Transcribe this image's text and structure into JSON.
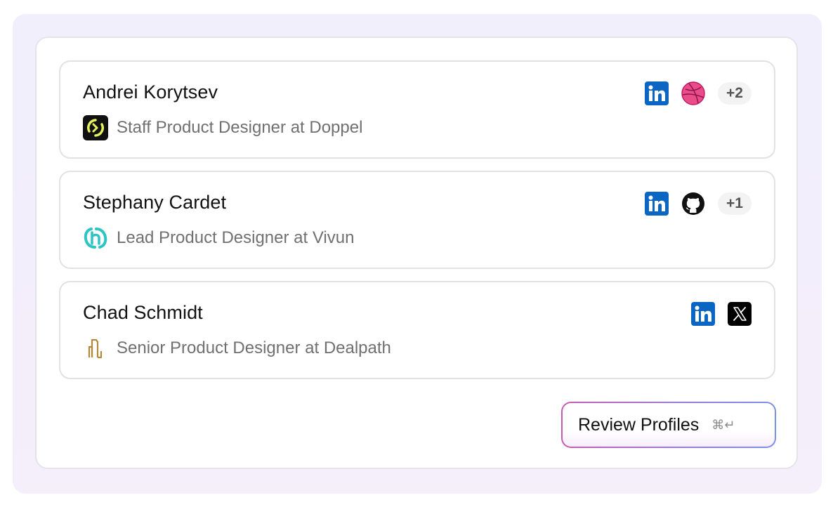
{
  "profiles": [
    {
      "name": "Andrei Korytsev",
      "role": "Staff Product Designer at Doppel",
      "company_logo": "doppel-logo",
      "socials": [
        "linkedin-icon",
        "dribbble-icon"
      ],
      "more": "+2"
    },
    {
      "name": "Stephany Cardet",
      "role": "Lead Product Designer at Vivun",
      "company_logo": "vivun-logo",
      "socials": [
        "linkedin-icon",
        "github-icon"
      ],
      "more": "+1"
    },
    {
      "name": "Chad Schmidt",
      "role": "Senior Product Designer at Dealpath",
      "company_logo": "dealpath-logo",
      "socials": [
        "linkedin-icon",
        "x-icon"
      ],
      "more": ""
    }
  ],
  "action": {
    "label": "Review Profiles",
    "shortcut": "⌘↵"
  },
  "colors": {
    "linkedin": "#0A66C2",
    "dribbble": "#EA4C89",
    "vivun": "#2CC4C4",
    "dealpath": "#B08A3A",
    "doppel_bg": "#111111",
    "doppel_accent": "#E4F25C"
  }
}
